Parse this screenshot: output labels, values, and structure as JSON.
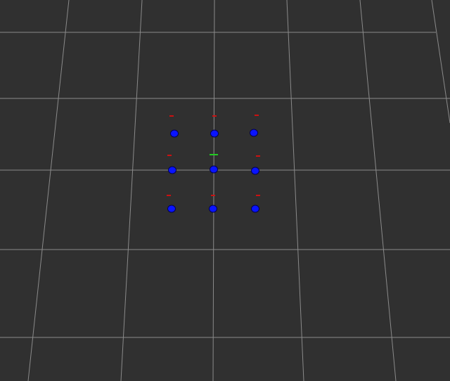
{
  "scene": {
    "background_color": "#303030",
    "grid_color": "#8a8a8a",
    "marker_color": "#0a14ff",
    "marker_outline_color": "#000055",
    "arrow_color": "#cc1111",
    "center_arrow_color": "#22cc22",
    "marker_grid": {
      "rows": 3,
      "cols": 3
    },
    "markers": [
      {
        "row": 0,
        "col": 0,
        "arrow": "red"
      },
      {
        "row": 0,
        "col": 1,
        "arrow": "red"
      },
      {
        "row": 0,
        "col": 2,
        "arrow": "red"
      },
      {
        "row": 1,
        "col": 0,
        "arrow": "red"
      },
      {
        "row": 1,
        "col": 1,
        "arrow": "green"
      },
      {
        "row": 1,
        "col": 2,
        "arrow": "red"
      },
      {
        "row": 2,
        "col": 0,
        "arrow": "red"
      },
      {
        "row": 2,
        "col": 1,
        "arrow": "red"
      },
      {
        "row": 2,
        "col": 2,
        "arrow": "red"
      }
    ]
  }
}
